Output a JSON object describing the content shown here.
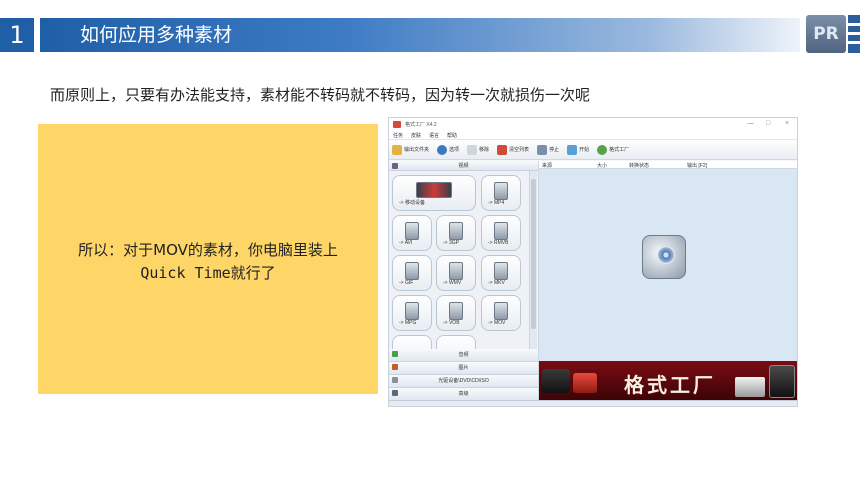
{
  "slide": {
    "number": "1",
    "title": "如何应用多种素材",
    "logo_text": "PR",
    "intro": "而原则上，只要有办法能支持，素材能不转码就不转码，因为转一次就损伤一次呢",
    "note_line1": "所以：对于MOV的素材，你电脑里装上",
    "note_line2": "Quick Time就行了"
  },
  "app": {
    "window_title": "格式工厂 X4.2",
    "window_controls": [
      "—",
      "□",
      "×"
    ],
    "menu": [
      "任务",
      "皮肤",
      "语言",
      "帮助"
    ],
    "toolbar": [
      "输出文件夹",
      "选项",
      "移除",
      "清空列表",
      "停止",
      "开始",
      "格式工厂"
    ],
    "category_video": "视频",
    "tiles": [
      {
        "label": "-> 移动设备"
      },
      {
        "label": "-> MP4"
      },
      {
        "label": "-> AVI"
      },
      {
        "label": "-> 3GP"
      },
      {
        "label": "-> RMVB"
      },
      {
        "label": "-> GIF"
      },
      {
        "label": "-> WMV"
      },
      {
        "label": "-> MKV"
      },
      {
        "label": "-> MPG"
      },
      {
        "label": "-> VOB"
      },
      {
        "label": "-> MOV"
      }
    ],
    "bottom_categories": [
      "音频",
      "图片",
      "光驱设备\\DVD\\CD\\ISO",
      "高级"
    ],
    "list_headers": [
      "来源",
      "大小",
      "转换状态",
      "输出 [F2]"
    ],
    "banner_text": "格式工厂",
    "colors": {
      "accent": "#1f5fa8",
      "note_bg": "#fdd667",
      "banner": "#7a0c12"
    }
  }
}
